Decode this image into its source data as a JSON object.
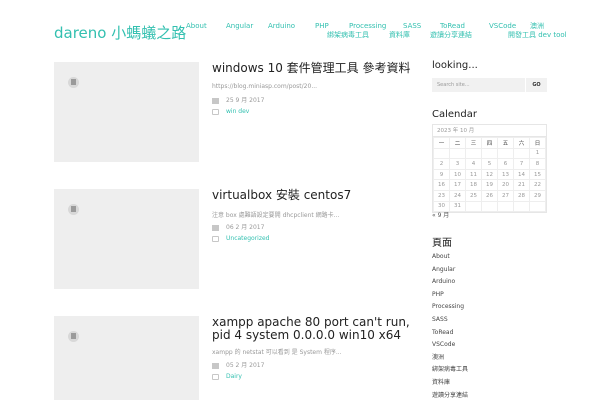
{
  "site_title": "dareno 小螞蟻之路",
  "nav": {
    "about": "About",
    "angular": "Angular",
    "arduino": "Arduino",
    "php": "PHP",
    "processing": "Processing",
    "sass": "SASS",
    "toread": "ToRead",
    "vscode": "VSCode",
    "macau": "澳洲",
    "virus": "綁架病毒工具",
    "data": "資料庫",
    "share": "遊讀分享連結",
    "dev": "開發工具 dev tool"
  },
  "posts": [
    {
      "title": "windows 10 套件管理工具 參考資料",
      "excerpt": "https://blog.miniasp.com/post/20...",
      "date": "25 9 月 2017",
      "category": "win dev"
    },
    {
      "title": "virtualbox 安裝 centos7",
      "excerpt": "注意 box 處難語設定要開 dhcpclient 網路卡...",
      "date": "06 2 月 2017",
      "category": "Uncategorized"
    },
    {
      "title": "xampp apache 80 port can't run, pid 4 system 0.0.0.0 win10 x64",
      "excerpt": "xampp 的 netstat 可以看到 是 System 程序...",
      "date": "05 2 月 2017",
      "category": "Dairy"
    }
  ],
  "sidebar": {
    "search_title": "looking...",
    "search_placeholder": "Search site...",
    "search_button": "GO",
    "calendar_title": "Calendar",
    "calendar_caption": "2023 年 10 月",
    "weekdays": [
      "一",
      "二",
      "三",
      "四",
      "五",
      "六",
      "日"
    ],
    "weeks": [
      [
        "",
        "",
        "",
        "",
        "",
        "",
        "1"
      ],
      [
        "2",
        "3",
        "4",
        "5",
        "6",
        "7",
        "8"
      ],
      [
        "9",
        "10",
        "11",
        "12",
        "13",
        "14",
        "15"
      ],
      [
        "16",
        "17",
        "18",
        "19",
        "20",
        "21",
        "22"
      ],
      [
        "23",
        "24",
        "25",
        "26",
        "27",
        "28",
        "29"
      ],
      [
        "30",
        "31",
        "",
        "",
        "",
        "",
        ""
      ]
    ],
    "prev_month": "« 9 月",
    "pages_title": "頁面",
    "pages": [
      "About",
      "Angular",
      "Arduino",
      "PHP",
      "Processing",
      "SASS",
      "ToRead",
      "VSCode",
      "澳洲",
      "綁架病毒工具",
      "資料庫",
      "遊讀分享連結"
    ]
  },
  "colors": {
    "accent": "#33c0b0",
    "thumb_bg": "#eeeeee"
  }
}
